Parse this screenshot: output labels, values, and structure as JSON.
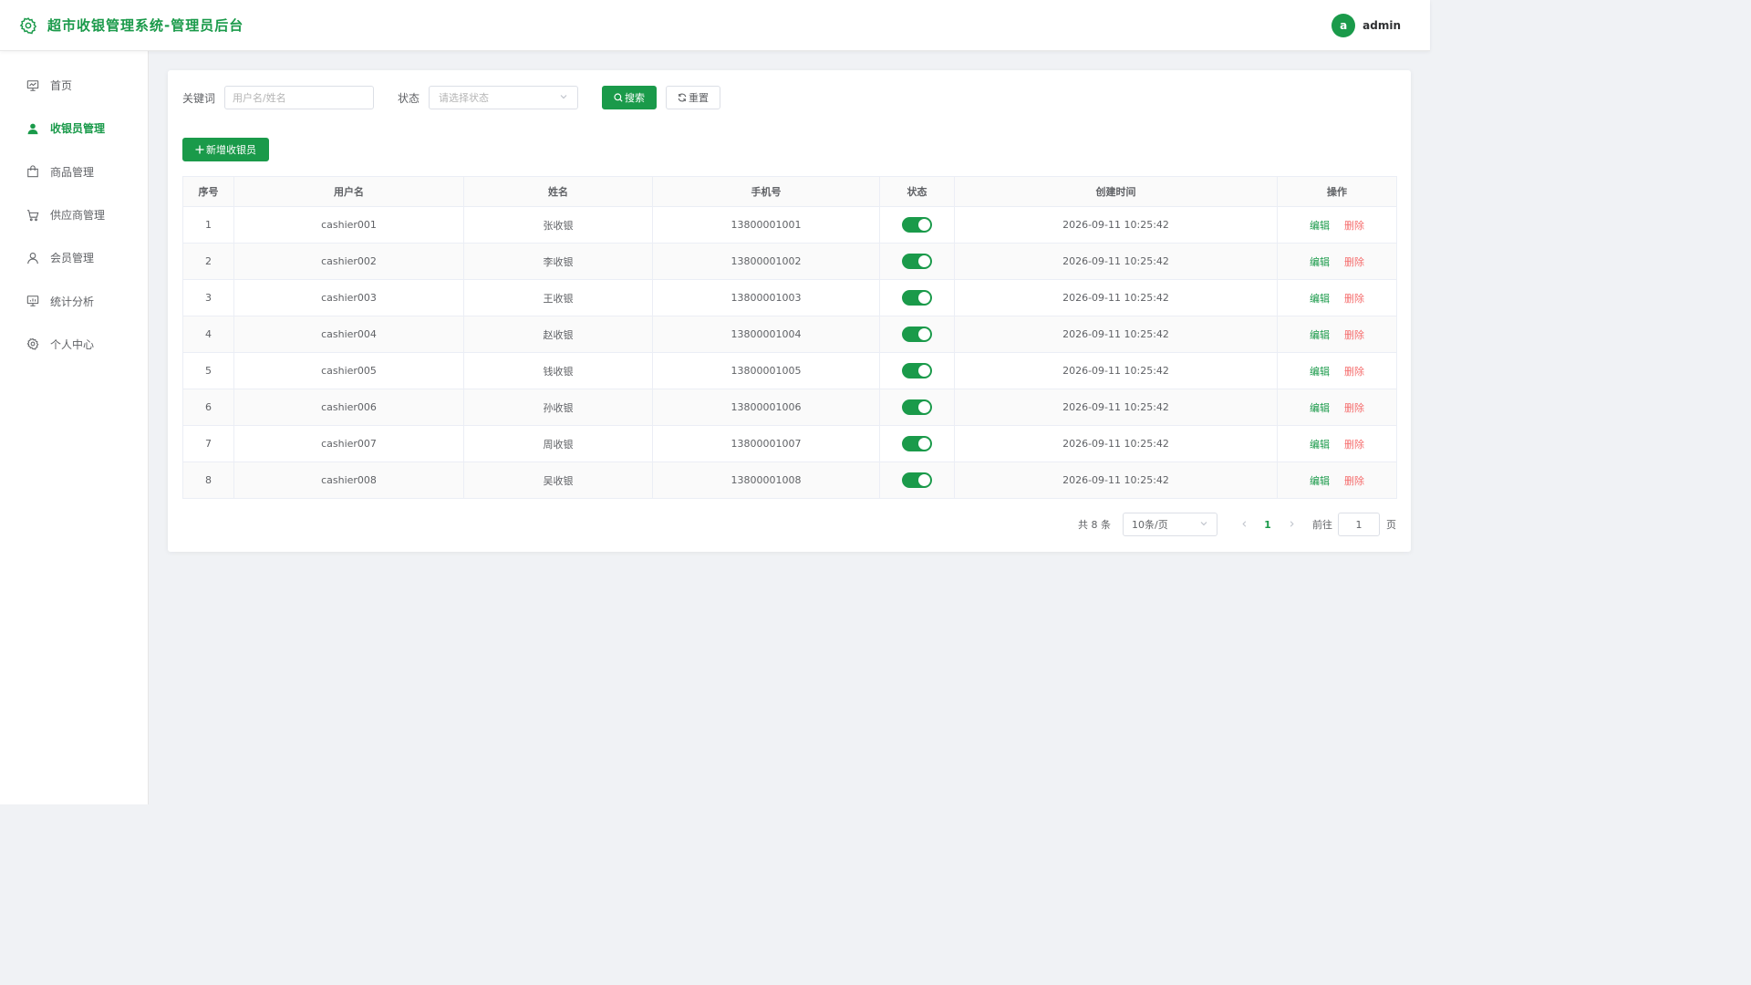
{
  "header": {
    "title": "超市收银管理系统-管理员后台",
    "avatar_letter": "a",
    "username": "admin"
  },
  "sidebar": {
    "items": [
      {
        "label": "首页",
        "icon": "dashboard-icon",
        "active": false
      },
      {
        "label": "收银员管理",
        "icon": "user-filled-icon",
        "active": true
      },
      {
        "label": "商品管理",
        "icon": "shopping-bag-icon",
        "active": false
      },
      {
        "label": "供应商管理",
        "icon": "cart-icon",
        "active": false
      },
      {
        "label": "会员管理",
        "icon": "user-icon",
        "active": false
      },
      {
        "label": "统计分析",
        "icon": "chart-board-icon",
        "active": false
      },
      {
        "label": "个人中心",
        "icon": "gear-icon",
        "active": false
      }
    ]
  },
  "filters": {
    "keyword_label": "关键词",
    "keyword_placeholder": "用户名/姓名",
    "status_label": "状态",
    "status_placeholder": "请选择状态",
    "search_label": "搜索",
    "reset_label": "重置"
  },
  "toolbar": {
    "add_label": "新增收银员"
  },
  "table": {
    "headers": [
      "序号",
      "用户名",
      "姓名",
      "手机号",
      "状态",
      "创建时间",
      "操作"
    ],
    "edit_label": "编辑",
    "delete_label": "删除",
    "rows": [
      {
        "index": "1",
        "username": "cashier001",
        "name": "张收银",
        "phone": "13800001001",
        "enabled": true,
        "created": "2026-09-11 10:25:42"
      },
      {
        "index": "2",
        "username": "cashier002",
        "name": "李收银",
        "phone": "13800001002",
        "enabled": true,
        "created": "2026-09-11 10:25:42"
      },
      {
        "index": "3",
        "username": "cashier003",
        "name": "王收银",
        "phone": "13800001003",
        "enabled": true,
        "created": "2026-09-11 10:25:42"
      },
      {
        "index": "4",
        "username": "cashier004",
        "name": "赵收银",
        "phone": "13800001004",
        "enabled": true,
        "created": "2026-09-11 10:25:42"
      },
      {
        "index": "5",
        "username": "cashier005",
        "name": "钱收银",
        "phone": "13800001005",
        "enabled": true,
        "created": "2026-09-11 10:25:42"
      },
      {
        "index": "6",
        "username": "cashier006",
        "name": "孙收银",
        "phone": "13800001006",
        "enabled": true,
        "created": "2026-09-11 10:25:42"
      },
      {
        "index": "7",
        "username": "cashier007",
        "name": "周收银",
        "phone": "13800001007",
        "enabled": true,
        "created": "2026-09-11 10:25:42"
      },
      {
        "index": "8",
        "username": "cashier008",
        "name": "吴收银",
        "phone": "13800001008",
        "enabled": true,
        "created": "2026-09-11 10:25:42"
      }
    ]
  },
  "pagination": {
    "total_text": "共 8 条",
    "page_size": "10条/页",
    "current_page": "1",
    "goto_label": "前往",
    "goto_value": "1",
    "page_unit": "页"
  },
  "colors": {
    "primary": "#1a9a4a",
    "danger": "#f56c6c"
  }
}
